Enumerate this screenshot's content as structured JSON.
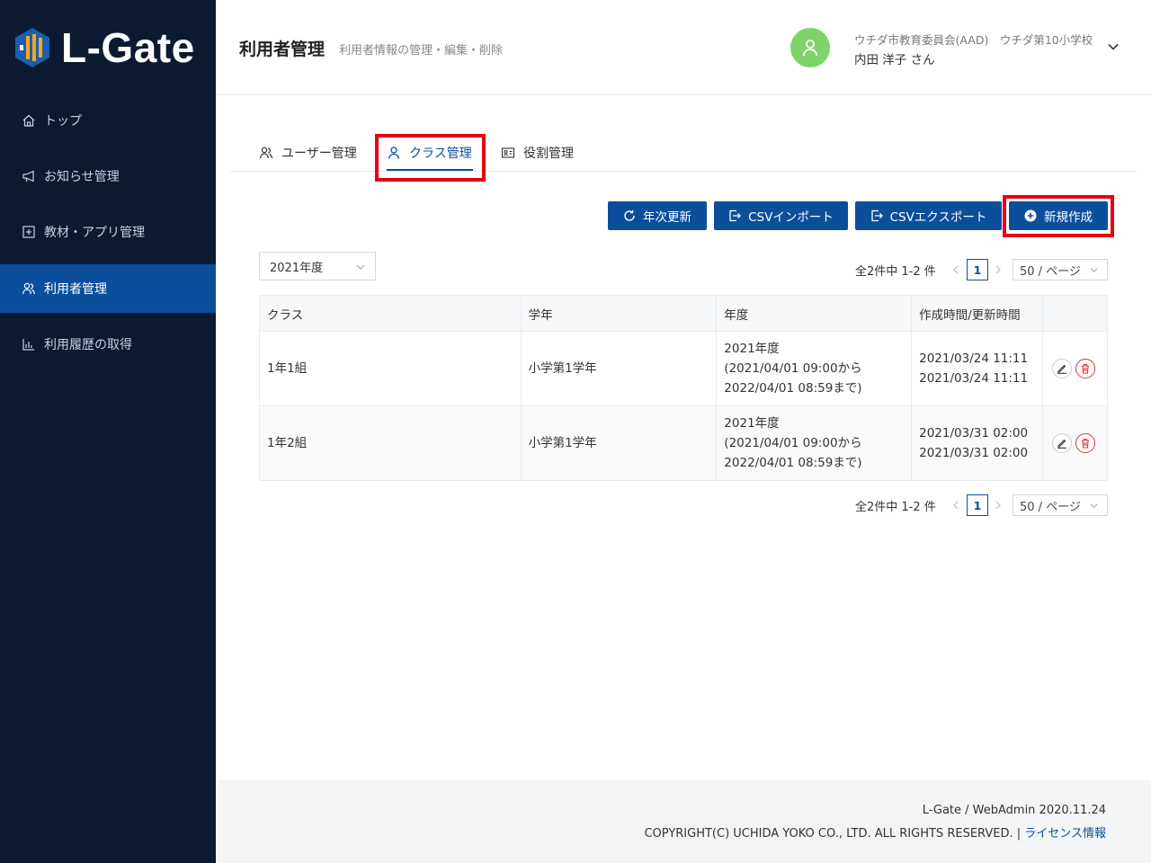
{
  "app": {
    "logo_text": "L-Gate"
  },
  "sidebar": {
    "items": [
      {
        "label": "トップ",
        "icon": "home-icon"
      },
      {
        "label": "お知らせ管理",
        "icon": "megaphone-icon"
      },
      {
        "label": "教材・アプリ管理",
        "icon": "plus-square-icon"
      },
      {
        "label": "利用者管理",
        "icon": "users-icon",
        "active": true
      },
      {
        "label": "利用履歴の取得",
        "icon": "bar-chart-icon"
      }
    ]
  },
  "header": {
    "title": "利用者管理",
    "subtitle": "利用者情報の管理・編集・削除",
    "user_org": "ウチダ市教育委員会(AAD)　ウチダ第10小学校",
    "user_name": "内田 洋子 さん"
  },
  "tabs": [
    {
      "label": "ユーザー管理",
      "icon": "users-icon"
    },
    {
      "label": "クラス管理",
      "icon": "user-icon",
      "active": true
    },
    {
      "label": "役割管理",
      "icon": "id-card-icon"
    }
  ],
  "toolbar": {
    "annual_update": "年次更新",
    "csv_import": "CSVインポート",
    "csv_export": "CSVエクスポート",
    "create_new": "新規作成"
  },
  "filter": {
    "year": "2021年度"
  },
  "pagination": {
    "total_text": "全2件中 1-2 件",
    "current_page": "1",
    "page_size": "50 / ページ"
  },
  "table": {
    "headers": [
      "クラス",
      "学年",
      "年度",
      "作成時間/更新時間"
    ],
    "rows": [
      {
        "class": "1年1組",
        "grade": "小学第1学年",
        "year_line1": "2021年度",
        "year_line2": "(2021/04/01 09:00から",
        "year_line3": "2022/04/01 08:59まで)",
        "created": "2021/03/24 11:11",
        "updated": "2021/03/24 11:11"
      },
      {
        "class": "1年2組",
        "grade": "小学第1学年",
        "year_line1": "2021年度",
        "year_line2": "(2021/04/01 09:00から",
        "year_line3": "2022/04/01 08:59まで)",
        "created": "2021/03/31 02:00",
        "updated": "2021/03/31 02:00"
      }
    ]
  },
  "footer": {
    "version": "L-Gate / WebAdmin 2020.11.24",
    "copyright": "COPYRIGHT(C) UCHIDA YOKO CO., LTD. ALL RIGHTS RESERVED. | ",
    "license_link": "ライセンス情報"
  },
  "colors": {
    "sidebar_bg": "#0b1a31",
    "primary": "#0b4f9c",
    "highlight": "#e60012",
    "avatar": "#7ed36a",
    "danger": "#e0303a"
  }
}
